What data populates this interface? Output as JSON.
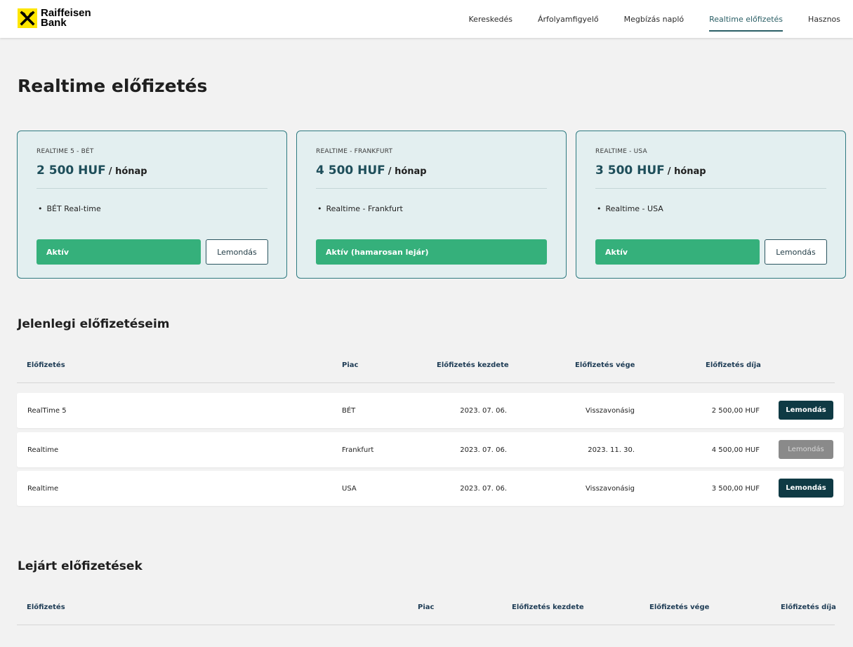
{
  "brand": {
    "line1": "Raiffeisen",
    "line2": "Bank",
    "logo_color": "#fee600"
  },
  "nav": [
    {
      "label": "Kereskedés",
      "active": false
    },
    {
      "label": "Árfolyamfigyelő",
      "active": false
    },
    {
      "label": "Megbízás napló",
      "active": false
    },
    {
      "label": "Realtime előfizetés",
      "active": true
    },
    {
      "label": "Hasznos",
      "active": false
    }
  ],
  "page_title": "Realtime előfizetés",
  "cards": [
    {
      "name": "REALTIME 5 - BÉT",
      "price": "2 500 HUF",
      "unit": "/ hónap",
      "feature": "BÉT Real-time",
      "status": "Aktív",
      "cancel": "Lemondás"
    },
    {
      "name": "REALTIME - FRANKFURT",
      "price": "4 500 HUF",
      "unit": "/ hónap",
      "feature": "Realtime - Frankfurt",
      "status": "Aktív (hamarosan lejár)",
      "cancel": ""
    },
    {
      "name": "REALTIME - USA",
      "price": "3 500 HUF",
      "unit": "/ hónap",
      "feature": "Realtime - USA",
      "status": "Aktív",
      "cancel": "Lemondás"
    }
  ],
  "current": {
    "title": "Jelenlegi előfizetéseim",
    "headers": {
      "subscription": "Előfizetés",
      "market": "Piac",
      "start": "Előfizetés kezdete",
      "end": "Előfizetés vége",
      "fee": "Előfizetés díja"
    },
    "rows": [
      {
        "subscription": "RealTime 5",
        "market": "BÉT",
        "start": "2023. 07. 06.",
        "end": "Visszavonásig",
        "fee": "2 500,00 HUF",
        "action": "Lemondás",
        "disabled": false
      },
      {
        "subscription": "Realtime",
        "market": "Frankfurt",
        "start": "2023. 07. 06.",
        "end": "2023. 11. 30.",
        "fee": "4 500,00 HUF",
        "action": "Lemondás",
        "disabled": true
      },
      {
        "subscription": "Realtime",
        "market": "USA",
        "start": "2023. 07. 06.",
        "end": "Visszavonásig",
        "fee": "3 500,00 HUF",
        "action": "Lemondás",
        "disabled": false
      }
    ]
  },
  "expired": {
    "title": "Lejárt előfizetések",
    "headers": {
      "subscription": "Előfizetés",
      "market": "Piac",
      "start": "Előfizetés kezdete",
      "end": "Előfizetés vége",
      "fee": "Előfizetés díja"
    }
  },
  "colors": {
    "accent": "#2b5f66",
    "active_green": "#35b07b",
    "dark_button": "#0f3a44",
    "disabled_button": "#8a8a8a"
  }
}
